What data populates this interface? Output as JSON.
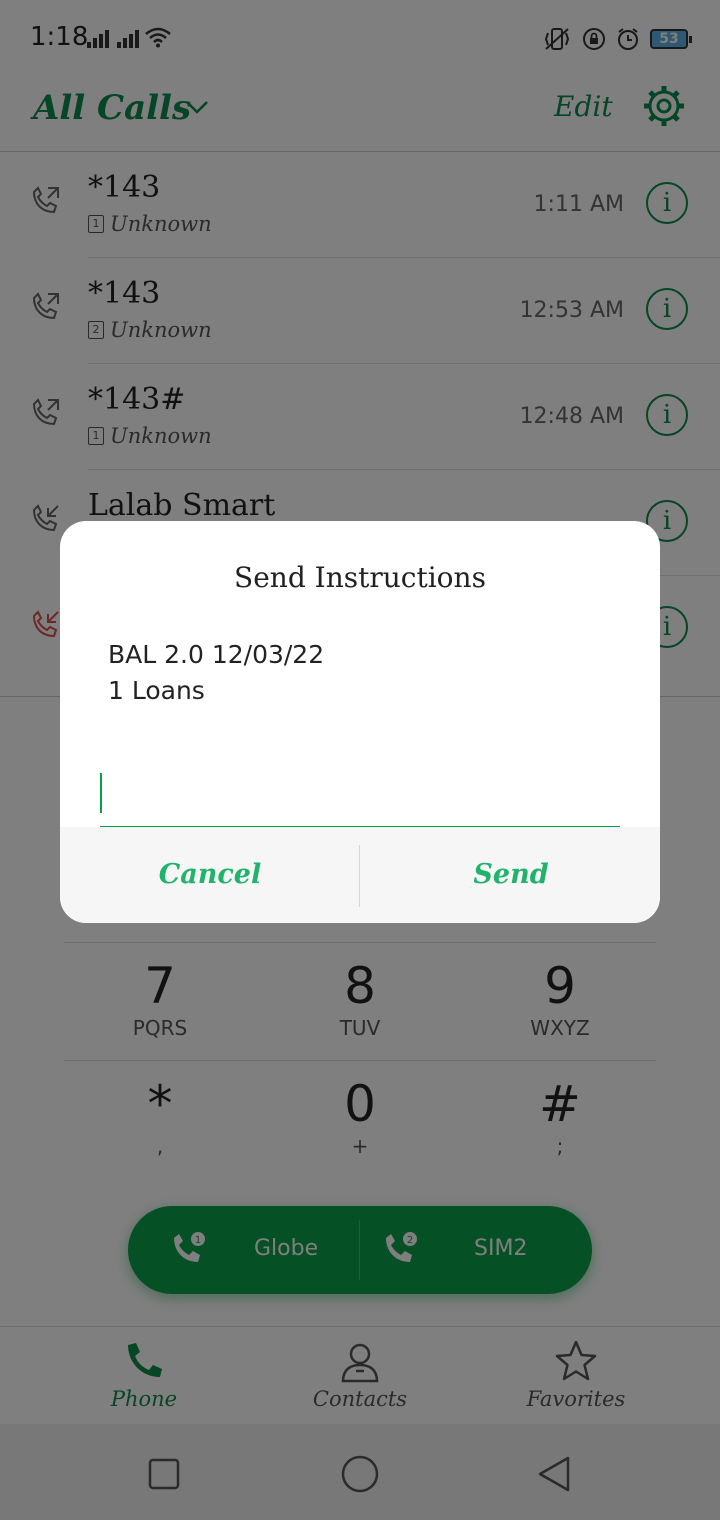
{
  "status_bar": {
    "time": "1:18",
    "battery": "53"
  },
  "header": {
    "title": "All Calls",
    "edit_label": "Edit"
  },
  "calls": [
    {
      "number": "*143",
      "sim": "1",
      "label": "Unknown",
      "time": "1:11 AM",
      "direction": "outgoing"
    },
    {
      "number": "*143",
      "sim": "2",
      "label": "Unknown",
      "time": "12:53 AM",
      "direction": "outgoing"
    },
    {
      "number": "*143#",
      "sim": "1",
      "label": "Unknown",
      "time": "12:48 AM",
      "direction": "outgoing"
    },
    {
      "number": "Lalab Smart",
      "direction": "incoming"
    },
    {
      "direction": "missed"
    }
  ],
  "dialpad": {
    "keys": [
      {
        "digit": "7",
        "letters": "PQRS"
      },
      {
        "digit": "8",
        "letters": "TUV"
      },
      {
        "digit": "9",
        "letters": "WXYZ"
      },
      {
        "digit": "*",
        "letters": ","
      },
      {
        "digit": "0",
        "letters": "+"
      },
      {
        "digit": "#",
        "letters": ";"
      }
    ]
  },
  "call_buttons": {
    "sim1_label": "Globe",
    "sim2_label": "SIM2"
  },
  "bottom_nav": {
    "phone": "Phone",
    "contacts": "Contacts",
    "favorites": "Favorites"
  },
  "dialog": {
    "title": "Send Instructions",
    "message_line1": "BAL 2.0 12/03/22",
    "message_line2": "1 Loans",
    "input_value": "",
    "cancel_label": "Cancel",
    "send_label": "Send"
  },
  "colors": {
    "accent": "#0d8a4a",
    "dialog_button": "#21b36b",
    "missed": "#d9534f"
  }
}
